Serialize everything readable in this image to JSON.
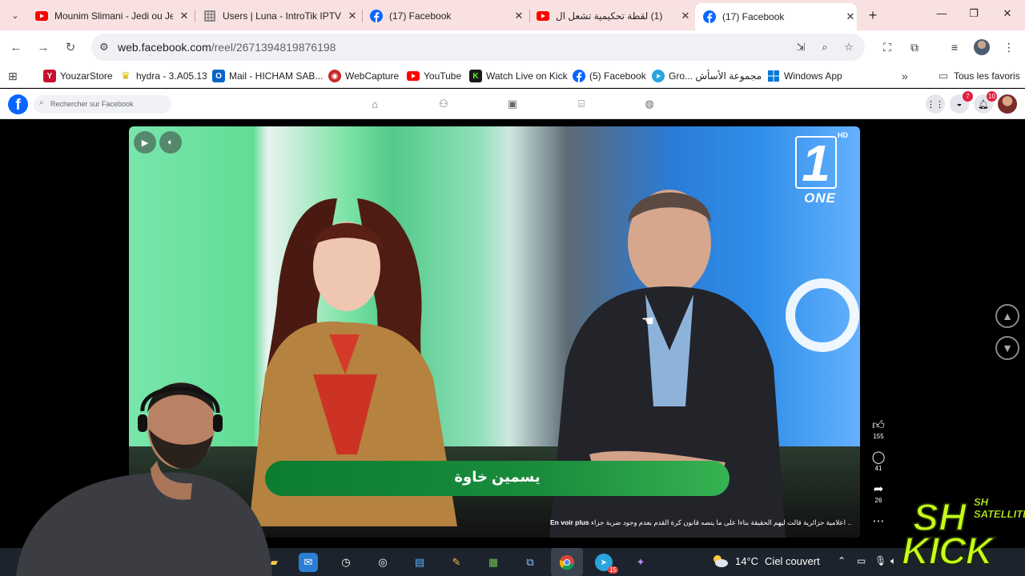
{
  "browser": {
    "tabs": [
      {
        "title": "Mounim Slimani - Jedi ou Je",
        "favicon": "youtube-icon",
        "active": false
      },
      {
        "title": "Users | Luna - IntroTik IPTV",
        "favicon": "sheet-icon",
        "active": false
      },
      {
        "title": "(17) Facebook",
        "favicon": "facebook-icon",
        "active": false
      },
      {
        "title": "(1) لقطة تحكيمية تشعل ال",
        "favicon": "youtube-icon",
        "active": false
      },
      {
        "title": "(17) Facebook",
        "favicon": "facebook-icon",
        "active": true
      }
    ],
    "url_domain": "web.facebook.com",
    "url_path": "/reel/2671394819876198",
    "bookmarks": [
      {
        "label": "YouzarStore",
        "icon": "y-icon",
        "color": "#c8102e"
      },
      {
        "label": "hydra - 3.A05.13",
        "icon": "hydra-icon",
        "color": "#d7b400"
      },
      {
        "label": "Mail - HICHAM SAB...",
        "icon": "outlook-icon",
        "color": "#0a64c8"
      },
      {
        "label": "WebCapture",
        "icon": "webcapture-icon",
        "color": "#c62828"
      },
      {
        "label": "YouTube",
        "icon": "youtube-icon",
        "color": "#ff0000"
      },
      {
        "label": "Watch Live on Kick",
        "icon": "kick-icon",
        "color": "#22c55e"
      },
      {
        "label": "(5) Facebook",
        "icon": "facebook-icon",
        "color": "#0866ff"
      },
      {
        "label": "Gro... مجموعة الأسأش",
        "icon": "telegram-icon",
        "color": "#2aa3de"
      },
      {
        "label": "Windows App",
        "icon": "windows-icon",
        "color": "#0078d4"
      }
    ],
    "all_bookmarks_label": "Tous les favoris"
  },
  "facebook": {
    "search_placeholder": "Rechercher sur Facebook",
    "nav_icons": [
      "home-icon",
      "friends-icon",
      "video-icon",
      "marketplace-icon",
      "gaming-icon"
    ],
    "messenger_badge": "7",
    "notifications_badge": "10"
  },
  "reel": {
    "channel_logo": "ONE",
    "channel_hd": "HD",
    "channel_number": "1",
    "nameplate": "يسمين خاوة",
    "caption": "اعلامية جزائرية  قالت ليهم الحقيقة بناءا على ما ينصه قانون كرة القدم بعدم وجود ضربة جزاء ...",
    "see_more": "En voir plus",
    "likes": "155",
    "comments": "41",
    "shares": "26"
  },
  "overlay": {
    "brand_sh": "SH",
    "brand_satellite_top": "SH",
    "brand_satellite": "SATELLITE",
    "brand_kick": "KICK"
  },
  "taskbar": {
    "temperature": "14°C",
    "weather": "Ciel couvert",
    "chrome_badge": "15"
  }
}
